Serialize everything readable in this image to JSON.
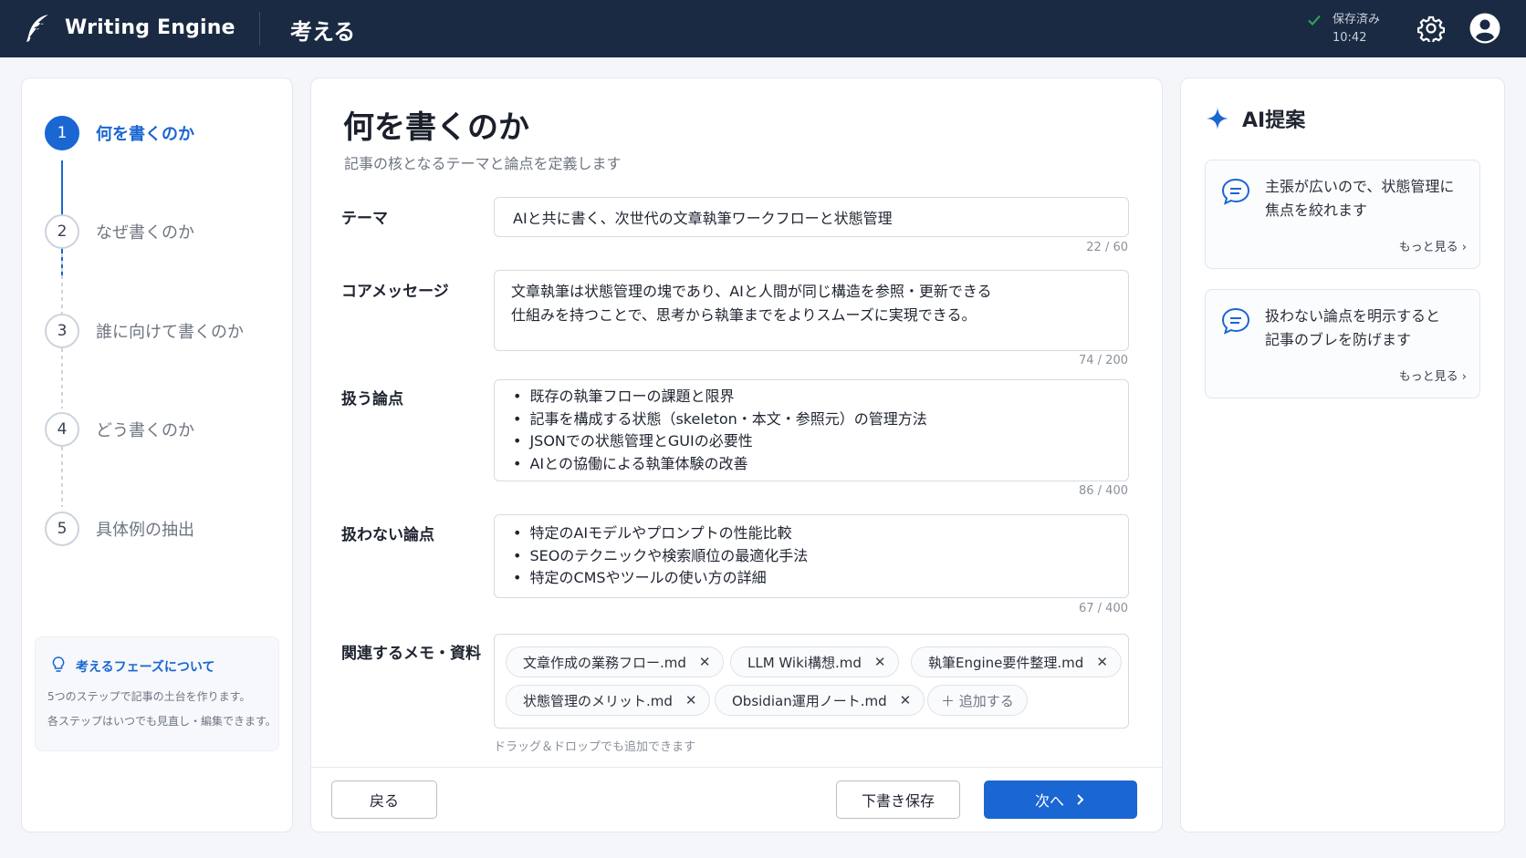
{
  "header": {
    "app_name": "Writing Engine",
    "phase_title": "考える",
    "save_status": "保存済み",
    "save_time": "10:42"
  },
  "stepper": {
    "steps": [
      {
        "num": "1",
        "label": "何を書くのか",
        "active": true
      },
      {
        "num": "2",
        "label": "なぜ書くのか"
      },
      {
        "num": "3",
        "label": "誰に向けて書くのか"
      },
      {
        "num": "4",
        "label": "どう書くのか"
      },
      {
        "num": "5",
        "label": "具体例の抽出"
      }
    ],
    "info": {
      "title": "考えるフェーズについて",
      "lines": [
        "5つのステップで記事の土台を作ります。",
        "各ステップはいつでも見直し・編集できます。"
      ]
    }
  },
  "main": {
    "title": "何を書くのか",
    "subtitle": "記事の核となるテーマと論点を定義します",
    "theme": {
      "label": "テーマ",
      "value": "AIと共に書く、次世代の文章執筆ワークフローと状態管理",
      "counter": "22 / 60"
    },
    "core": {
      "label": "コアメッセージ",
      "lines": [
        "文章執筆は状態管理の塊であり、AIと人間が同じ構造を参照・更新できる",
        "仕組みを持つことで、思考から執筆までをよりスムーズに実現できる。"
      ],
      "counter": "74 / 200"
    },
    "covered": {
      "label": "扱う論点",
      "items": [
        "既存の執筆フローの課題と限界",
        "記事を構成する状態（skeleton・本文・参照元）の管理方法",
        "JSONでの状態管理とGUIの必要性",
        "AIとの協働による執筆体験の改善"
      ],
      "counter": "86 / 400"
    },
    "excluded": {
      "label": "扱わない論点",
      "items": [
        "特定のAIモデルやプロンプトの性能比較",
        "SEOのテクニックや検索順位の最適化手法",
        "特定のCMSやツールの使い方の詳細"
      ],
      "counter": "67 / 400"
    },
    "refs": {
      "label": "関連するメモ・資料",
      "chips": [
        "文章作成の業務フロー.md",
        "LLM Wiki構想.md",
        "執筆Engine要件整理.md",
        "状態管理のメリット.md",
        "Obsidian運用ノート.md"
      ],
      "add_label": "＋ 追加する",
      "remove_glyph": "✕",
      "hint": "ドラッグ＆ドロップでも追加できます"
    },
    "buttons": {
      "back": "戻る",
      "draft": "下書き保存",
      "next": "次へ"
    }
  },
  "ai_panel": {
    "title": "AI提案",
    "suggestions": [
      {
        "lines": [
          "主張が広いので、状態管理に",
          "焦点を絞れます"
        ],
        "more": "もっと見る"
      },
      {
        "lines": [
          "扱わない論点を明示すると",
          "記事のブレを防げます"
        ],
        "more": "もっと見る"
      }
    ]
  },
  "colors": {
    "header_bg": "#1a2a42",
    "accent": "#1a66d2",
    "check": "#2eaa5c"
  }
}
